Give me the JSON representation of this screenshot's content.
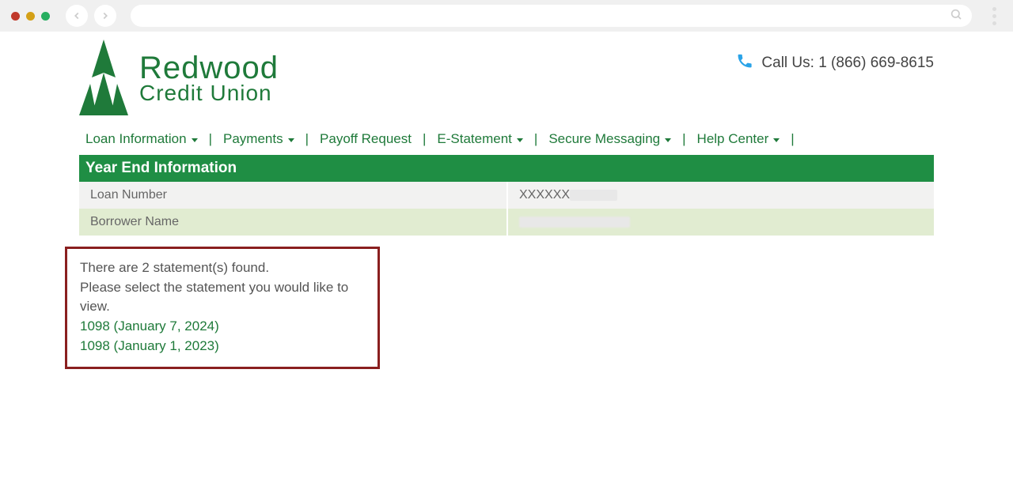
{
  "brand": {
    "top": "Redwood",
    "bottom": "Credit Union"
  },
  "callus": {
    "label": "Call Us: 1 (866) 669-8615"
  },
  "nav": {
    "items": [
      {
        "label": "Loan Information",
        "dropdown": true
      },
      {
        "label": "Payments",
        "dropdown": true
      },
      {
        "label": "Payoff Request",
        "dropdown": false
      },
      {
        "label": "E-Statement",
        "dropdown": true
      },
      {
        "label": "Secure Messaging",
        "dropdown": true
      },
      {
        "label": "Help Center",
        "dropdown": true
      }
    ]
  },
  "section": {
    "title": "Year End Information"
  },
  "info": {
    "loan_number_label": "Loan Number",
    "loan_number_value": "XXXXXX",
    "borrower_name_label": "Borrower Name",
    "borrower_name_value": ""
  },
  "statements": {
    "count_msg": "There are 2 statement(s) found.",
    "instruction": "Please select the statement you would like to view.",
    "links": [
      "1098 (January 7, 2024)",
      "1098 (January 1, 2023)"
    ]
  }
}
